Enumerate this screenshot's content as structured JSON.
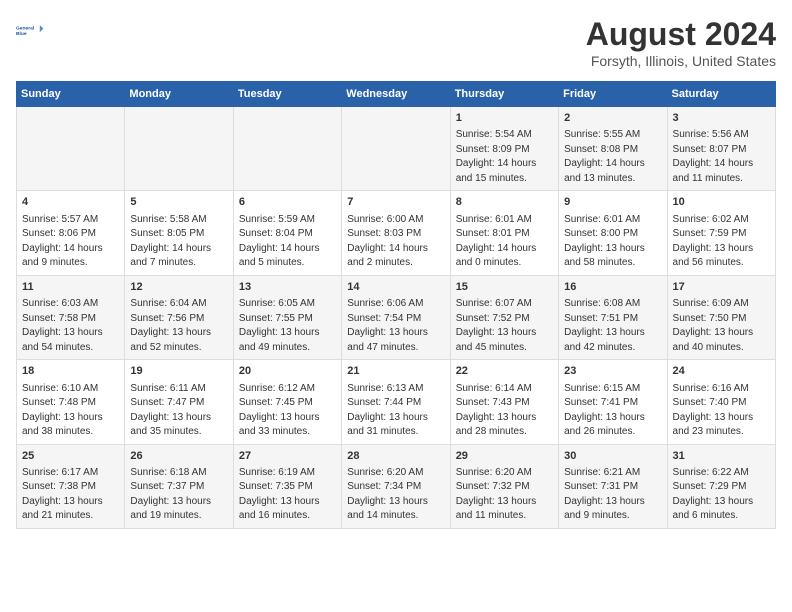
{
  "logo": {
    "line1": "General",
    "line2": "Blue"
  },
  "title": "August 2024",
  "subtitle": "Forsyth, Illinois, United States",
  "days_of_week": [
    "Sunday",
    "Monday",
    "Tuesday",
    "Wednesday",
    "Thursday",
    "Friday",
    "Saturday"
  ],
  "weeks": [
    [
      {
        "day": "",
        "info": ""
      },
      {
        "day": "",
        "info": ""
      },
      {
        "day": "",
        "info": ""
      },
      {
        "day": "",
        "info": ""
      },
      {
        "day": "1",
        "info": "Sunrise: 5:54 AM\nSunset: 8:09 PM\nDaylight: 14 hours\nand 15 minutes."
      },
      {
        "day": "2",
        "info": "Sunrise: 5:55 AM\nSunset: 8:08 PM\nDaylight: 14 hours\nand 13 minutes."
      },
      {
        "day": "3",
        "info": "Sunrise: 5:56 AM\nSunset: 8:07 PM\nDaylight: 14 hours\nand 11 minutes."
      }
    ],
    [
      {
        "day": "4",
        "info": "Sunrise: 5:57 AM\nSunset: 8:06 PM\nDaylight: 14 hours\nand 9 minutes."
      },
      {
        "day": "5",
        "info": "Sunrise: 5:58 AM\nSunset: 8:05 PM\nDaylight: 14 hours\nand 7 minutes."
      },
      {
        "day": "6",
        "info": "Sunrise: 5:59 AM\nSunset: 8:04 PM\nDaylight: 14 hours\nand 5 minutes."
      },
      {
        "day": "7",
        "info": "Sunrise: 6:00 AM\nSunset: 8:03 PM\nDaylight: 14 hours\nand 2 minutes."
      },
      {
        "day": "8",
        "info": "Sunrise: 6:01 AM\nSunset: 8:01 PM\nDaylight: 14 hours\nand 0 minutes."
      },
      {
        "day": "9",
        "info": "Sunrise: 6:01 AM\nSunset: 8:00 PM\nDaylight: 13 hours\nand 58 minutes."
      },
      {
        "day": "10",
        "info": "Sunrise: 6:02 AM\nSunset: 7:59 PM\nDaylight: 13 hours\nand 56 minutes."
      }
    ],
    [
      {
        "day": "11",
        "info": "Sunrise: 6:03 AM\nSunset: 7:58 PM\nDaylight: 13 hours\nand 54 minutes."
      },
      {
        "day": "12",
        "info": "Sunrise: 6:04 AM\nSunset: 7:56 PM\nDaylight: 13 hours\nand 52 minutes."
      },
      {
        "day": "13",
        "info": "Sunrise: 6:05 AM\nSunset: 7:55 PM\nDaylight: 13 hours\nand 49 minutes."
      },
      {
        "day": "14",
        "info": "Sunrise: 6:06 AM\nSunset: 7:54 PM\nDaylight: 13 hours\nand 47 minutes."
      },
      {
        "day": "15",
        "info": "Sunrise: 6:07 AM\nSunset: 7:52 PM\nDaylight: 13 hours\nand 45 minutes."
      },
      {
        "day": "16",
        "info": "Sunrise: 6:08 AM\nSunset: 7:51 PM\nDaylight: 13 hours\nand 42 minutes."
      },
      {
        "day": "17",
        "info": "Sunrise: 6:09 AM\nSunset: 7:50 PM\nDaylight: 13 hours\nand 40 minutes."
      }
    ],
    [
      {
        "day": "18",
        "info": "Sunrise: 6:10 AM\nSunset: 7:48 PM\nDaylight: 13 hours\nand 38 minutes."
      },
      {
        "day": "19",
        "info": "Sunrise: 6:11 AM\nSunset: 7:47 PM\nDaylight: 13 hours\nand 35 minutes."
      },
      {
        "day": "20",
        "info": "Sunrise: 6:12 AM\nSunset: 7:45 PM\nDaylight: 13 hours\nand 33 minutes."
      },
      {
        "day": "21",
        "info": "Sunrise: 6:13 AM\nSunset: 7:44 PM\nDaylight: 13 hours\nand 31 minutes."
      },
      {
        "day": "22",
        "info": "Sunrise: 6:14 AM\nSunset: 7:43 PM\nDaylight: 13 hours\nand 28 minutes."
      },
      {
        "day": "23",
        "info": "Sunrise: 6:15 AM\nSunset: 7:41 PM\nDaylight: 13 hours\nand 26 minutes."
      },
      {
        "day": "24",
        "info": "Sunrise: 6:16 AM\nSunset: 7:40 PM\nDaylight: 13 hours\nand 23 minutes."
      }
    ],
    [
      {
        "day": "25",
        "info": "Sunrise: 6:17 AM\nSunset: 7:38 PM\nDaylight: 13 hours\nand 21 minutes."
      },
      {
        "day": "26",
        "info": "Sunrise: 6:18 AM\nSunset: 7:37 PM\nDaylight: 13 hours\nand 19 minutes."
      },
      {
        "day": "27",
        "info": "Sunrise: 6:19 AM\nSunset: 7:35 PM\nDaylight: 13 hours\nand 16 minutes."
      },
      {
        "day": "28",
        "info": "Sunrise: 6:20 AM\nSunset: 7:34 PM\nDaylight: 13 hours\nand 14 minutes."
      },
      {
        "day": "29",
        "info": "Sunrise: 6:20 AM\nSunset: 7:32 PM\nDaylight: 13 hours\nand 11 minutes."
      },
      {
        "day": "30",
        "info": "Sunrise: 6:21 AM\nSunset: 7:31 PM\nDaylight: 13 hours\nand 9 minutes."
      },
      {
        "day": "31",
        "info": "Sunrise: 6:22 AM\nSunset: 7:29 PM\nDaylight: 13 hours\nand 6 minutes."
      }
    ]
  ],
  "colors": {
    "header_bg": "#2962a8",
    "header_text": "#ffffff",
    "odd_row": "#f5f5f5",
    "even_row": "#ffffff"
  }
}
